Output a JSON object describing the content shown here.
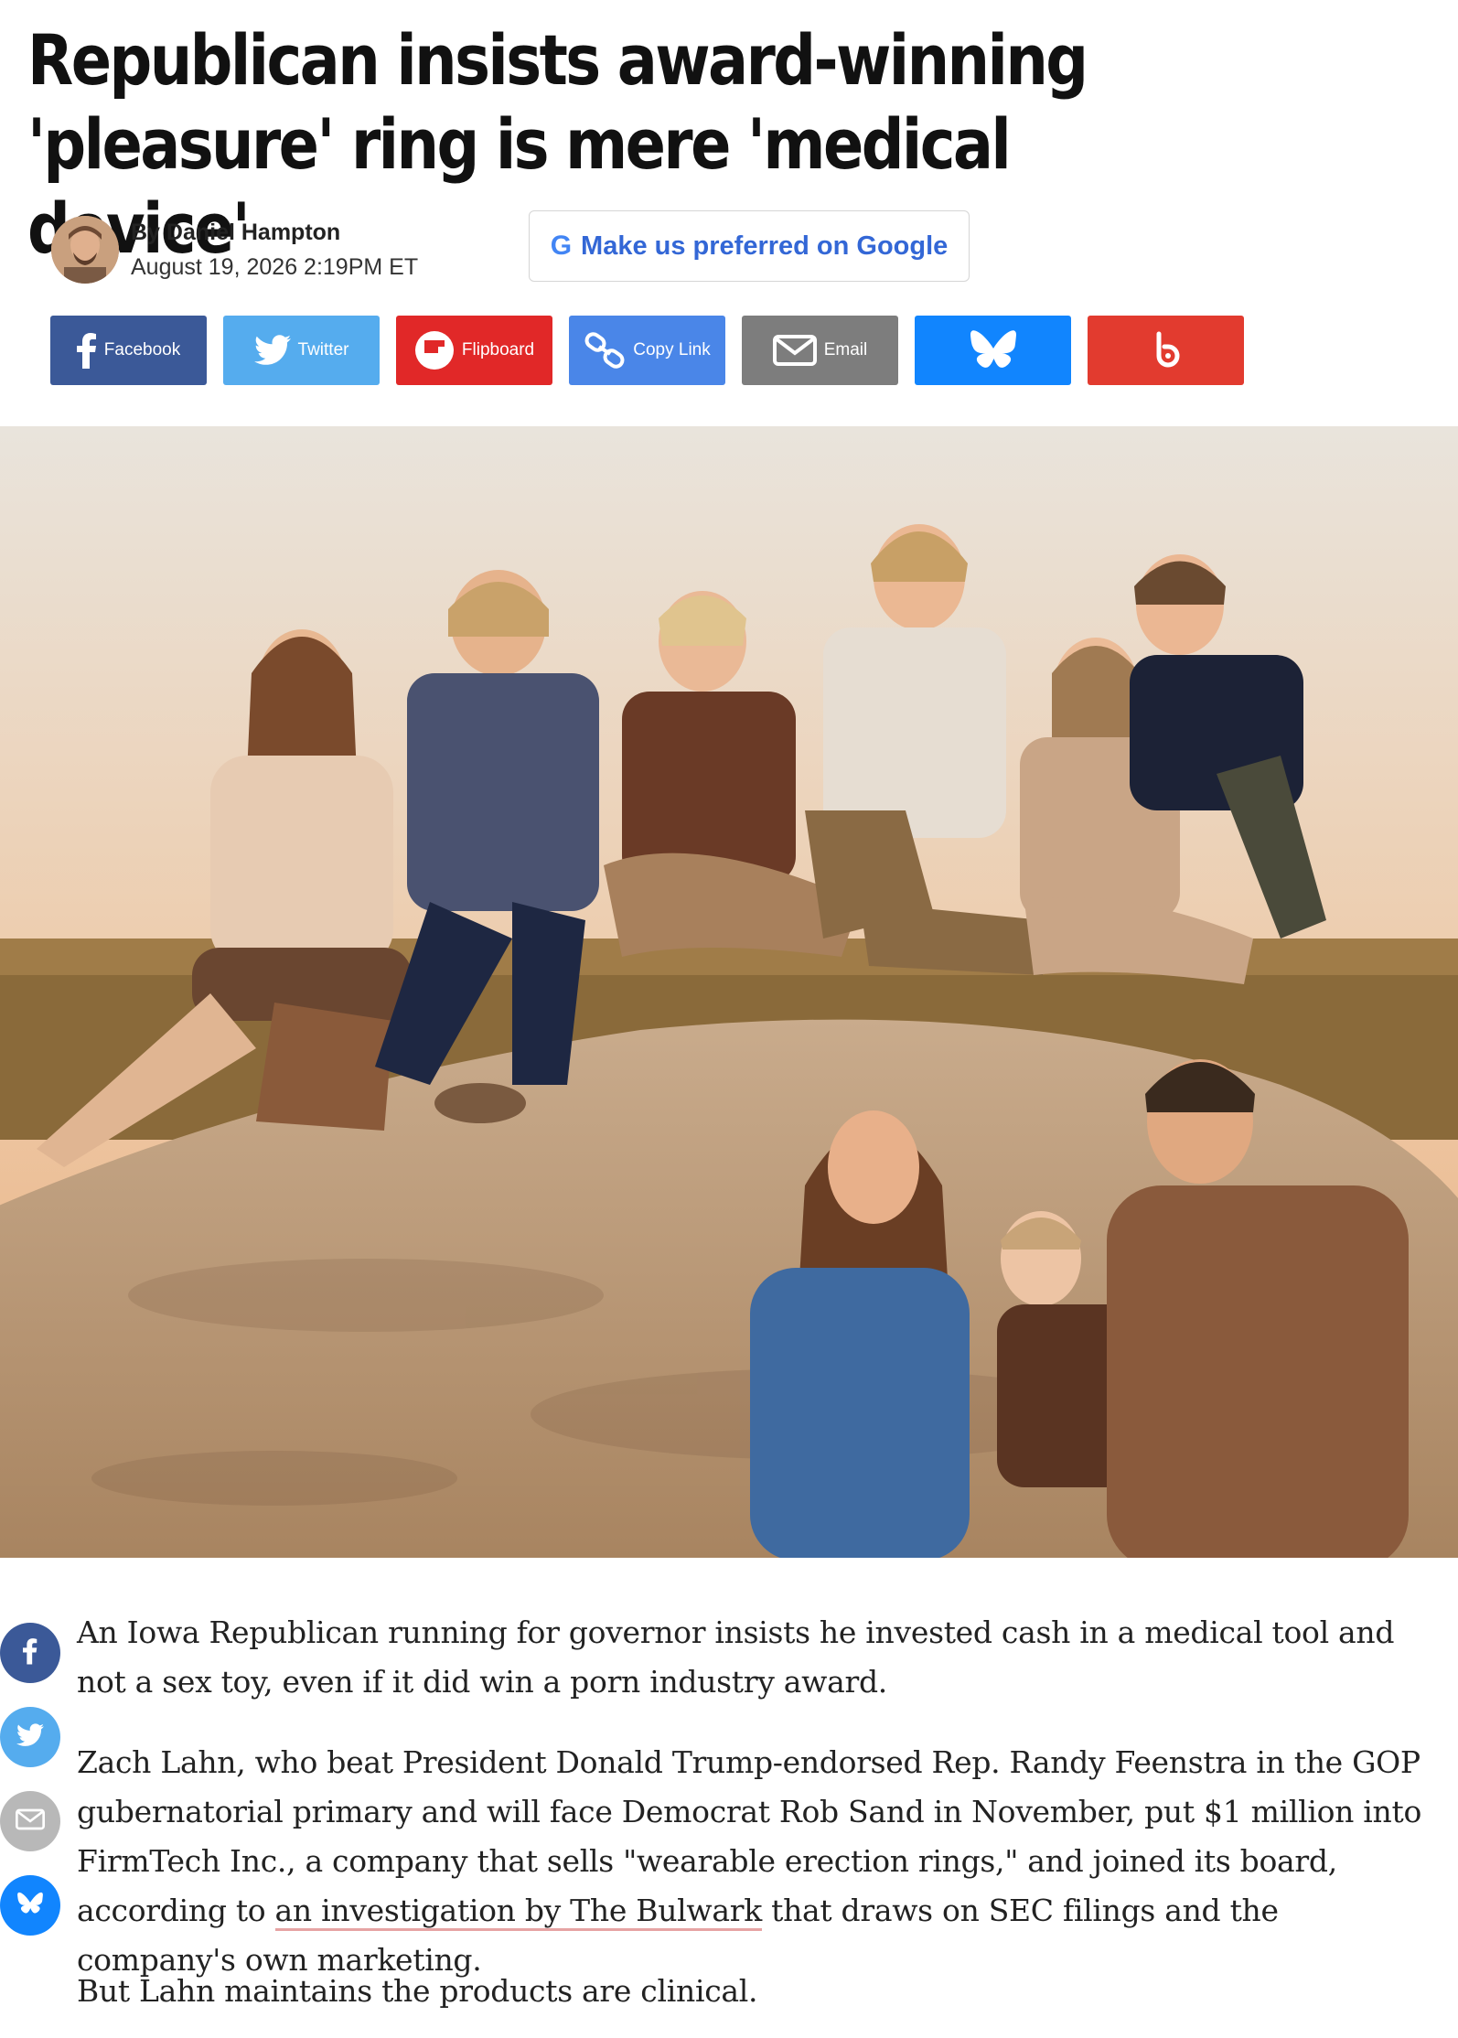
{
  "article": {
    "headline": "Republican insists award-winning 'pleasure' ring is mere 'medical device'",
    "author": "By Daniel Hampton",
    "date": "August 19, 2026 2:19PM ET",
    "google_pref_label": "Make us preferred on Google",
    "google_glyph": "G"
  },
  "share": {
    "facebook": "Facebook",
    "twitter": "Twitter",
    "flipboard": "Flipboard",
    "copy_link": "Copy Link",
    "email": "Email"
  },
  "colors": {
    "facebook": "#3b5998",
    "twitter": "#55acee",
    "flipboard": "#e12828",
    "copy_link": "#4a86e8",
    "email": "#7d7d7d",
    "bluesky": "#1185fe",
    "red_share": "#e23b2f",
    "link_accent": "#3367d6"
  },
  "icons": [
    "facebook-icon",
    "twitter-icon",
    "flipboard-icon",
    "link-icon",
    "email-icon",
    "bluesky-icon",
    "brand-b-icon"
  ],
  "body": {
    "p1": "An Iowa Republican running for governor insists he invested cash in a medical tool and not a sex toy, even if it did win a porn industry award.",
    "p2_before": "Zach Lahn, who beat President Donald Trump-endorsed Rep. Randy Feenstra in the GOP gubernatorial primary and will face Democrat Rob Sand in November, put $1 million into FirmTech Inc., a company that sells \"wearable erection rings,\" and joined its board, according to ",
    "p2_link": "an investigation by The Bulwark",
    "p2_after": " that draws on SEC filings and the company's own marketing.",
    "p3": "But Lahn maintains the products are clinical."
  }
}
